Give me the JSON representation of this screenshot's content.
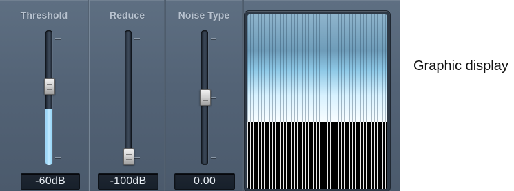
{
  "plugin": {
    "controls": [
      {
        "label": "Threshold",
        "value": "-60dB",
        "position_fraction": 0.58,
        "fill_fraction": 0.42
      },
      {
        "label": "Reduce",
        "value": "-100dB",
        "position_fraction": 0.06,
        "fill_fraction": 0
      },
      {
        "label": "Noise Type",
        "value": "0.00",
        "position_fraction": 0.5,
        "fill_fraction": 0
      }
    ],
    "graphic_display": {
      "label": "Graphic display"
    }
  },
  "colors": {
    "panel": "#536376",
    "title_text": "#b7c2cf",
    "active_fill": "#9bd8f8",
    "display_upper": "#b9dff2",
    "display_lower": "#000000"
  }
}
